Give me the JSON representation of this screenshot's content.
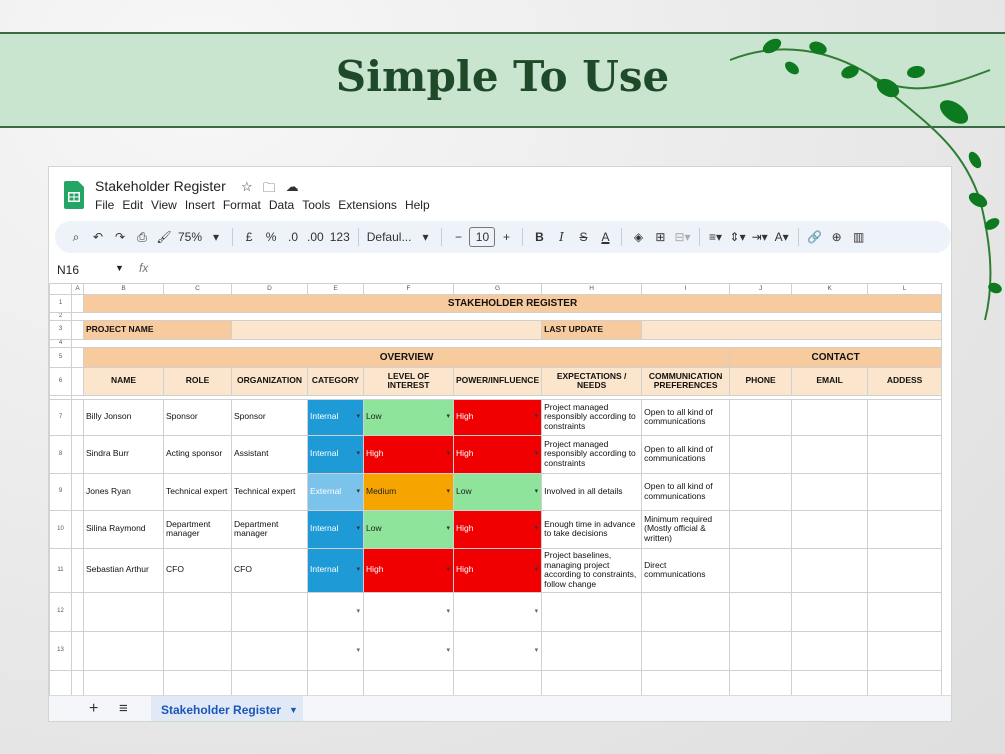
{
  "banner": {
    "title": "Simple To Use"
  },
  "app": {
    "doc_title": "Stakeholder Register",
    "menu": [
      "File",
      "Edit",
      "View",
      "Insert",
      "Format",
      "Data",
      "Tools",
      "Extensions",
      "Help"
    ],
    "toolbar": {
      "zoom": "75%",
      "currency": "£",
      "percent": "%",
      "dec_decrease": ".0",
      "dec_increase": ".00",
      "number_format": "123",
      "font": "Defaul...",
      "font_size": "10"
    },
    "cell_ref": "N16",
    "fx": "fx"
  },
  "sheet": {
    "columns": [
      "A",
      "B",
      "C",
      "D",
      "E",
      "F",
      "G",
      "H",
      "I",
      "J",
      "K",
      "L"
    ],
    "title": "STAKEHOLDER REGISTER",
    "project_name_label": "PROJECT NAME",
    "last_update_label": "LAST UPDATE",
    "overview_label": "OVERVIEW",
    "contact_label": "CONTACT",
    "headers": [
      "NAME",
      "ROLE",
      "ORGANIZATION",
      "CATEGORY",
      "LEVEL OF INTEREST",
      "POWER/INFLUENCE",
      "EXPECTATIONS / NEEDS",
      "COMMUNICATION PREFERENCES",
      "PHONE",
      "EMAIL",
      "ADDESS"
    ],
    "rows": [
      {
        "num": "7",
        "name": "Billy Jonson",
        "role": "Sponsor",
        "org": "Sponsor",
        "category": "Internal",
        "interest": "Low",
        "power": "High",
        "expectations": "Project managed responsibly according to constraints",
        "comms": "Open to all kind of communications"
      },
      {
        "num": "8",
        "name": "Sindra Burr",
        "role": "Acting sponsor",
        "org": "Assistant",
        "category": "Internal",
        "interest": "High",
        "power": "High",
        "expectations": "Project managed responsibly according to constraints",
        "comms": "Open to all kind of communications"
      },
      {
        "num": "9",
        "name": "Jones Ryan",
        "role": "Technical expert",
        "org": "Technical expert",
        "category": "External",
        "interest": "Medium",
        "power": "Low",
        "expectations": "Involved in all details",
        "comms": "Open to all kind of communications"
      },
      {
        "num": "10",
        "name": "Silina Raymond",
        "role": "Department manager",
        "org": "Department manager",
        "category": "Internal",
        "interest": "Low",
        "power": "High",
        "expectations": "Enough time in advance to take decisions",
        "comms": "Minimum required (Mostly official & written)"
      },
      {
        "num": "11",
        "name": "Sebastian Arthur",
        "role": "CFO",
        "org": "CFO",
        "category": "Internal",
        "interest": "High",
        "power": "High",
        "expectations": "Project baselines, managing project according to constraints, follow change",
        "comms": "Direct communications"
      }
    ],
    "row_numbers": {
      "r1": "1",
      "r2": "2",
      "r3": "3",
      "r4": "4",
      "r5": "5",
      "r6": "6",
      "r12": "12",
      "r13": "13"
    }
  },
  "tabs": {
    "active": "Stakeholder Register"
  },
  "colors": {
    "internal": "#1e9bd7",
    "external": "#7bc3ea",
    "low": "#8ee49a",
    "medium": "#f6a500",
    "high": "#f00000",
    "header_orange": "#f8cb9f",
    "banner": "#c9e4cf"
  }
}
